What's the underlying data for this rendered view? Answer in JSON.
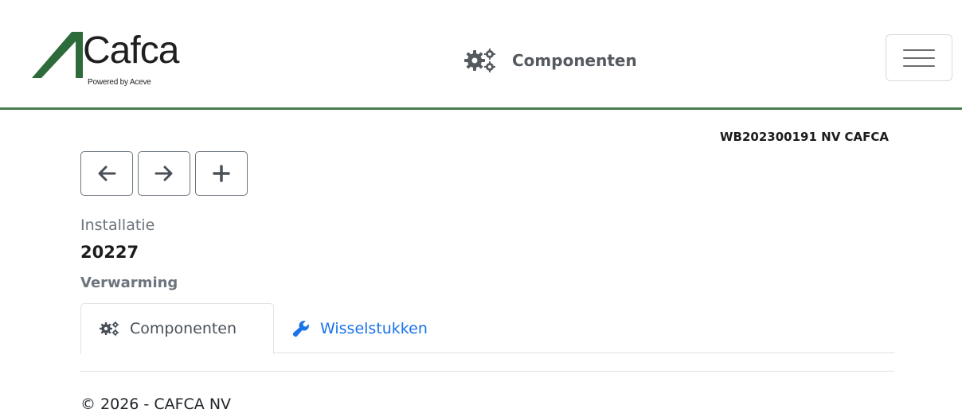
{
  "header": {
    "logo": {
      "brand": "Cafca",
      "tagline": "Powered by Aceve"
    },
    "title": "Componenten",
    "title_icon": "gears-icon",
    "menu_icon": "hamburger-menu-icon",
    "accent_color": "#4a7c4e"
  },
  "account": {
    "label": "WB202300191 NV CAFCA"
  },
  "toolbar": {
    "buttons": [
      {
        "icon": "arrow-left-icon"
      },
      {
        "icon": "arrow-right-icon"
      },
      {
        "icon": "plus-icon"
      }
    ]
  },
  "installation": {
    "label": "Installatie",
    "number": "20227",
    "type": "Verwarming"
  },
  "tabs": [
    {
      "label": "Componenten",
      "icon": "gears-icon",
      "active": true
    },
    {
      "label": "Wisselstukken",
      "icon": "wrench-icon",
      "active": false
    }
  ],
  "footer": {
    "copyright": "© 2026 - CAFCA NV"
  },
  "colors": {
    "link": "#1a73e8",
    "muted": "#6c757d"
  }
}
